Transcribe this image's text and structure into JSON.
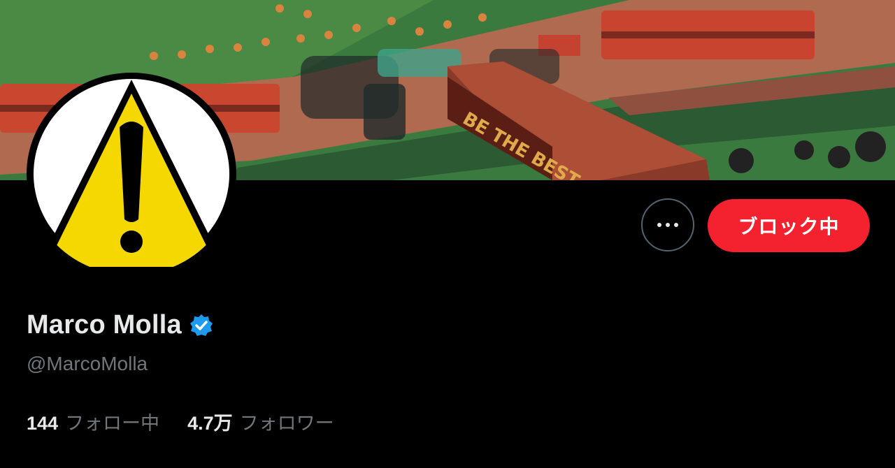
{
  "profile": {
    "display_name": "Marco Molla",
    "handle": "@MarcoMolla",
    "verified": true
  },
  "actions": {
    "more_icon": "more-horizontal-icon",
    "block_label": "ブロック中"
  },
  "stats": {
    "following_count": "144",
    "following_label": "フォロー中",
    "followers_count": "4.7万",
    "followers_label": "フォロワー"
  },
  "banner": {
    "tunnel_text": "BE THE BEST"
  },
  "colors": {
    "background": "#000000",
    "accent_block": "#f4212e",
    "verified": "#1d9bf0",
    "secondary_text": "#71767b",
    "warning_yellow": "#f5d800"
  }
}
